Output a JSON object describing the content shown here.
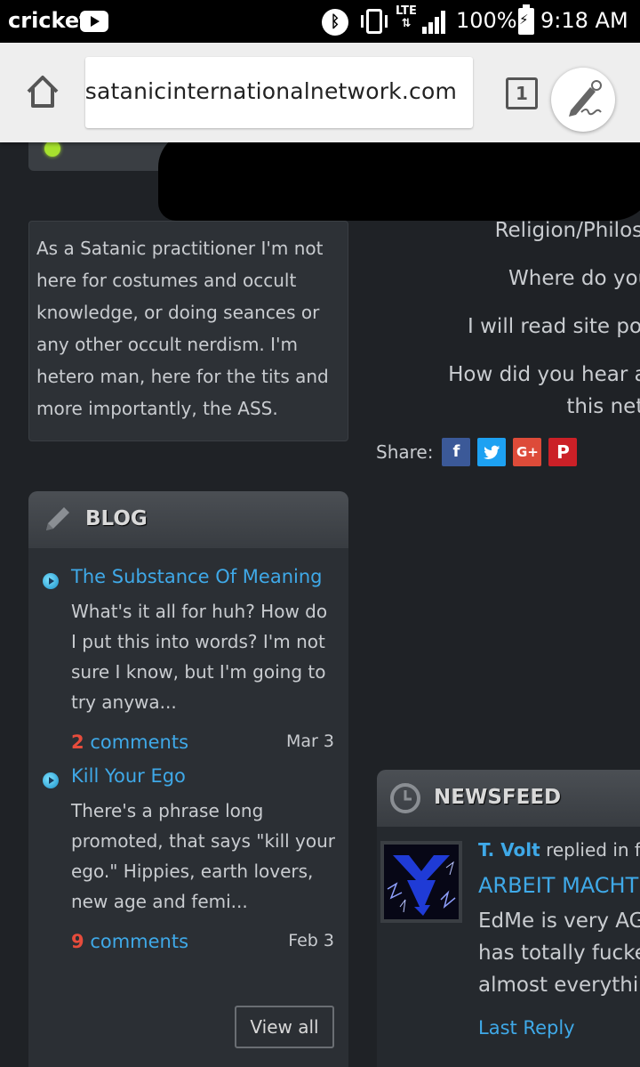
{
  "status_bar": {
    "carrier": "cricket",
    "network": "LTE",
    "battery": "100%",
    "time": "9:18 AM"
  },
  "browser": {
    "url": "satanicinternationalnetwork.com",
    "tab_count": "1"
  },
  "profile": {
    "about": "As a Satanic practitioner I'm not here for costumes and occult knowledge, or doing seances or any other occult nerdism. I'm hetero man, here for the tits and more importantly, the ASS.",
    "fields": [
      "Religion/Philosophy",
      "Where do you live",
      "I will read site policies",
      "How did you hear about",
      "this network"
    ],
    "share_label": "Share:"
  },
  "share_buttons": [
    {
      "icon": "facebook-icon",
      "glyph": "f",
      "color": "#3b5998"
    },
    {
      "icon": "twitter-icon",
      "glyph": "🐦",
      "color": "#1da1f2"
    },
    {
      "icon": "google-plus-icon",
      "glyph": "G+",
      "color": "#dd4b39"
    },
    {
      "icon": "pinterest-icon",
      "glyph": "P",
      "color": "#cb2027"
    }
  ],
  "blog": {
    "title": "BLOG",
    "posts": [
      {
        "title": "The Substance Of Meaning",
        "excerpt": "What's it all for huh? How do I put this into words? I'm not sure I know, but I'm going to try anywa...",
        "comment_count": "2",
        "comment_label": "comments",
        "date": "Mar 3"
      },
      {
        "title": "Kill Your Ego",
        "excerpt": "There's a phrase long promoted, that says \"kill your ego.\" Hippies, earth lovers, new age and femi...",
        "comment_count": "9",
        "comment_label": "comments",
        "date": "Feb 3"
      }
    ],
    "view_all": "View all"
  },
  "newsfeed": {
    "title": "NEWSFEED",
    "user": "T. Volt",
    "action": "replied in forum",
    "topic": "ARBEIT MACHT FREI",
    "text": "EdMe is very AGAIN\nhas totally fucked\nalmost everything",
    "last_reply": "Last Reply"
  },
  "colors": {
    "link": "#3fa9e8",
    "comment_count": "#e74c3c",
    "status_dot": "#a6e22e"
  }
}
